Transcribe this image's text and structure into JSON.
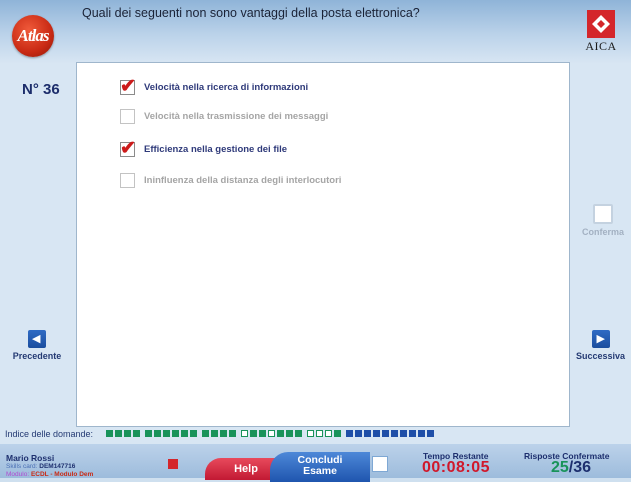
{
  "header": {
    "logo_text": "Atlas",
    "question": "Quali dei seguenti non sono vantaggi della posta elettronica?",
    "org_logo_text": "AICA"
  },
  "question_number": "N° 36",
  "answers": [
    {
      "label": "Velocità nella ricerca di informazioni",
      "checked": true,
      "enabled": true
    },
    {
      "label": "Velocità nella trasmissione dei messaggi",
      "checked": false,
      "enabled": false
    },
    {
      "label": "Efficienza nella gestione dei file",
      "checked": true,
      "enabled": true
    },
    {
      "label": "Ininfluenza della distanza degli interlocutori",
      "checked": false,
      "enabled": false
    }
  ],
  "nav": {
    "confirm": "Conferma",
    "previous": "Precedente",
    "next": "Successiva"
  },
  "index": {
    "label": "Indice delle domande:",
    "states": [
      "done",
      "done",
      "done",
      "done",
      "gap",
      "done",
      "done",
      "done",
      "done",
      "done",
      "done",
      "gap",
      "done",
      "done",
      "done",
      "done",
      "gap",
      "open",
      "done",
      "done",
      "open",
      "done",
      "done",
      "done",
      "gap",
      "open",
      "open",
      "open",
      "done",
      "gap",
      "blue",
      "blue",
      "blue",
      "blue",
      "blue",
      "blue",
      "blue",
      "blue",
      "blue",
      "blue"
    ]
  },
  "footer": {
    "user_name": "Mario Rossi",
    "skills_card_label": "Skills card:",
    "skills_card_value": "DEM147716",
    "module_label": "Modulo:",
    "module_value": "ECDL - Modulo Dem",
    "help": "Help",
    "conclude_line1": "Concludi",
    "conclude_line2": "Esame",
    "time_label": "Tempo Restante",
    "time_value": "00:08:05",
    "confirmed_label": "Risposte Confermate",
    "confirmed_done": "25",
    "confirmed_total": "/36"
  },
  "colors": {
    "accent_red": "#d0182b",
    "accent_green": "#19935a",
    "accent_blue": "#1f4fa8"
  }
}
